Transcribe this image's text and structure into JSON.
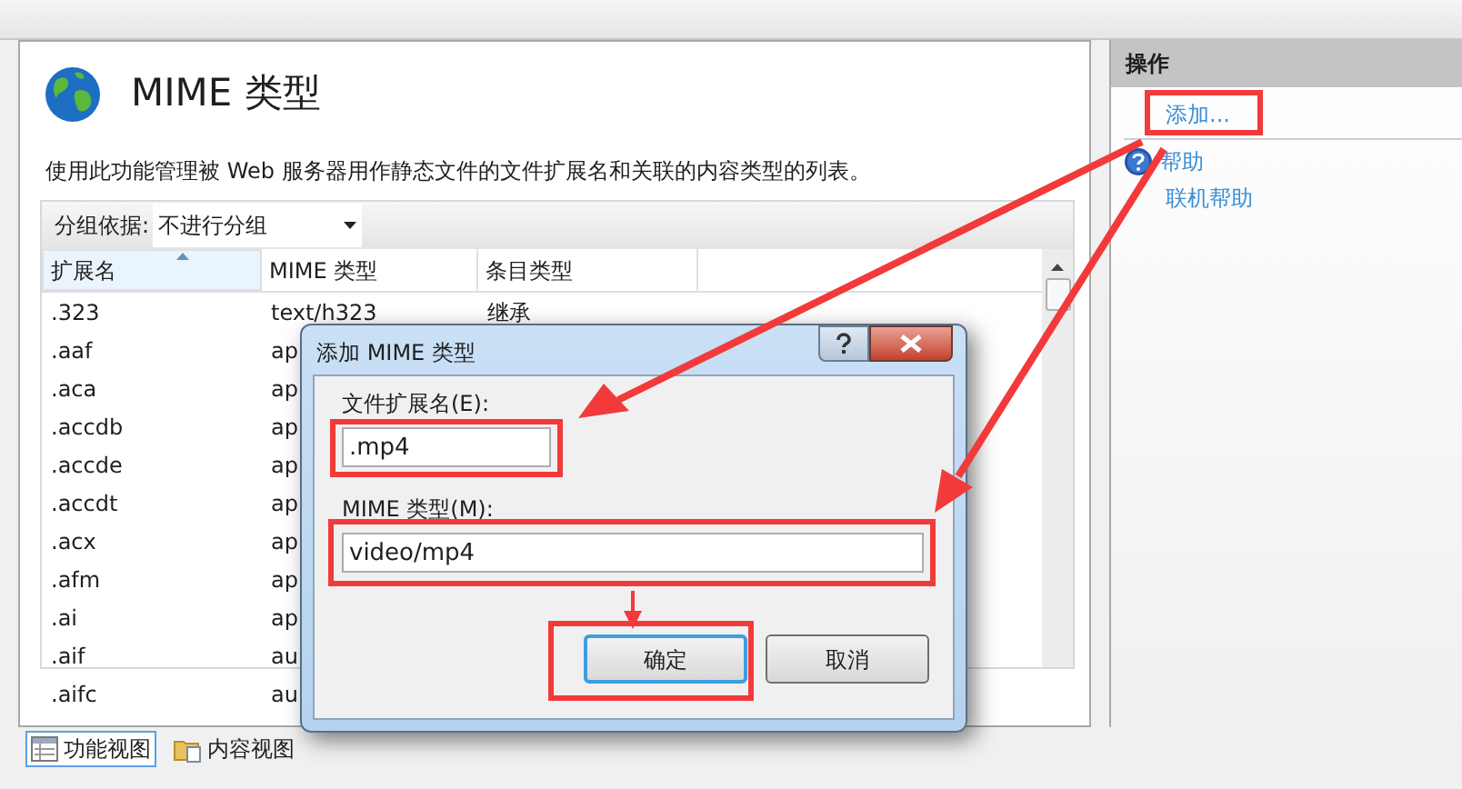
{
  "page": {
    "title": "MIME 类型",
    "description": "使用此功能管理被 Web 服务器用作静态文件的文件扩展名和关联的内容类型的列表。"
  },
  "group_by": {
    "label": "分组依据:",
    "value": "不进行分组"
  },
  "table": {
    "columns": [
      {
        "label": "扩展名",
        "sorted": true
      },
      {
        "label": "MIME 类型",
        "sorted": false
      },
      {
        "label": "条目类型",
        "sorted": false
      }
    ],
    "rows": [
      [
        ".323",
        "text/h323",
        "继承"
      ],
      [
        ".aaf",
        "ap"
      ],
      [
        ".aca",
        "ap"
      ],
      [
        ".accdb",
        "ap"
      ],
      [
        ".accde",
        "ap"
      ],
      [
        ".accdt",
        "ap"
      ],
      [
        ".acx",
        "ap"
      ],
      [
        ".afm",
        "ap"
      ],
      [
        ".ai",
        "ap"
      ],
      [
        ".aif",
        "au"
      ],
      [
        ".aifc",
        "au"
      ]
    ]
  },
  "view_tabs": [
    {
      "label": "功能视图",
      "selected": true
    },
    {
      "label": "内容视图",
      "selected": false
    }
  ],
  "actions": {
    "title": "操作",
    "items": [
      {
        "label": "添加...",
        "kind": "link"
      },
      {
        "label": "帮助",
        "kind": "help"
      },
      {
        "label": "联机帮助",
        "kind": "link"
      }
    ]
  },
  "dialog": {
    "title": "添加 MIME 类型",
    "fields": [
      {
        "label": "文件扩展名(E):",
        "value": ".mp4"
      },
      {
        "label": "MIME 类型(M):",
        "value": "video/mp4"
      }
    ],
    "buttons": [
      {
        "label": "确定",
        "default": true
      },
      {
        "label": "取消",
        "default": false
      }
    ]
  }
}
